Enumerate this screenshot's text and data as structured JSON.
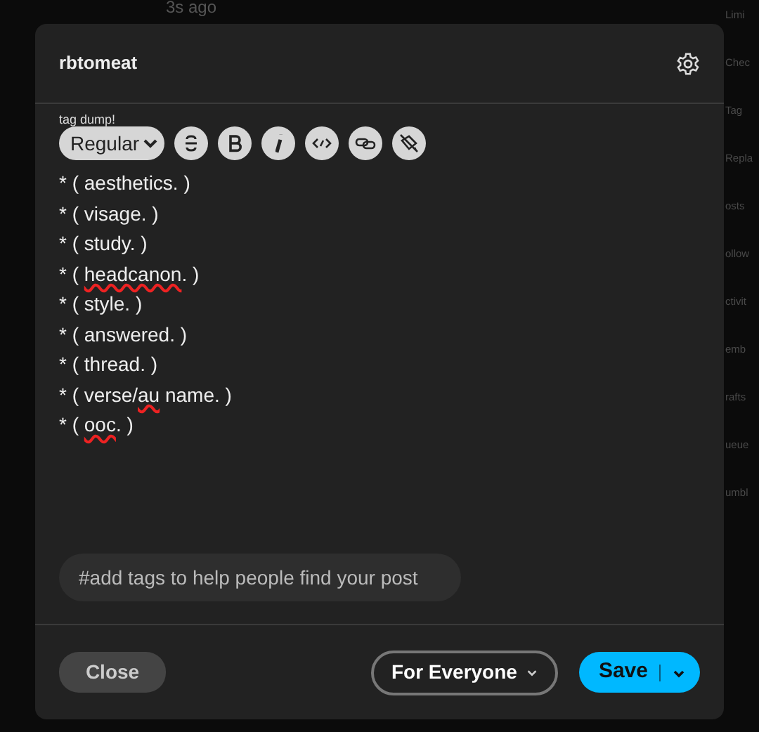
{
  "background": {
    "post_time": "3s ago",
    "sidebar_items": [
      "Limi",
      "Chec",
      "Tag",
      "Repla",
      "osts",
      "ollow",
      "ctivit",
      "emb",
      "rafts",
      "ueue",
      "umbl"
    ]
  },
  "dialog": {
    "blog_name": "rbtomeat",
    "title": "tag dump!",
    "toolbar": {
      "text_style": "Regular",
      "buttons": [
        {
          "kind": "strike"
        },
        {
          "kind": "bold"
        },
        {
          "kind": "italic"
        },
        {
          "kind": "code"
        },
        {
          "kind": "link"
        },
        {
          "kind": "paint"
        }
      ]
    },
    "lines": [
      {
        "parts": [
          {
            "text": "* ( aesthetics. )",
            "misspelled": false
          }
        ]
      },
      {
        "parts": [
          {
            "text": "* ( visage. )",
            "misspelled": false
          }
        ]
      },
      {
        "parts": [
          {
            "text": "* ( study. )",
            "misspelled": false
          }
        ]
      },
      {
        "parts": [
          {
            "text": "* ( ",
            "misspelled": false
          },
          {
            "text": "headcanon",
            "misspelled": true
          },
          {
            "text": ". )",
            "misspelled": false
          }
        ]
      },
      {
        "parts": [
          {
            "text": "* ( style. )",
            "misspelled": false
          }
        ]
      },
      {
        "parts": [
          {
            "text": "* ( answered. )",
            "misspelled": false
          }
        ]
      },
      {
        "parts": [
          {
            "text": "* ( thread. )",
            "misspelled": false
          }
        ]
      },
      {
        "parts": [
          {
            "text": "* ( verse/",
            "misspelled": false
          },
          {
            "text": "au",
            "misspelled": true
          },
          {
            "text": " name. )",
            "misspelled": false
          }
        ]
      },
      {
        "parts": [
          {
            "text": "* ( ",
            "misspelled": false
          },
          {
            "text": "ooc",
            "misspelled": true
          },
          {
            "text": ". )",
            "misspelled": false
          }
        ]
      }
    ],
    "tags": {
      "placeholder": "#add tags to help people find your post"
    },
    "footer": {
      "close": "Close",
      "audience": "For Everyone",
      "save": "Save"
    }
  }
}
